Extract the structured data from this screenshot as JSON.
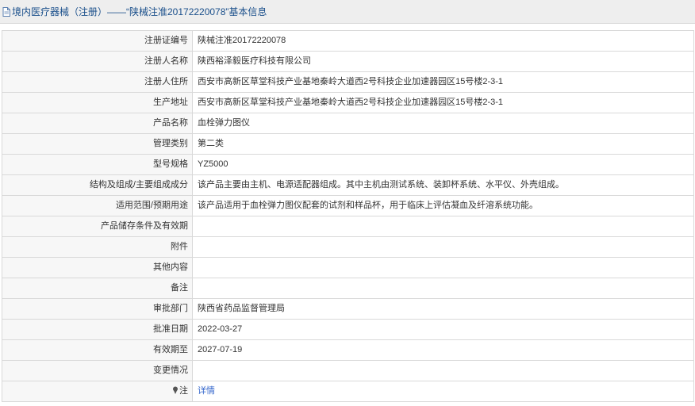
{
  "header": {
    "title": "境内医疗器械（注册）——“陕械注准20172220078”基本信息"
  },
  "rows": [
    {
      "label": "注册证编号",
      "value": "陕械注准20172220078"
    },
    {
      "label": "注册人名称",
      "value": "陕西裕泽毅医疗科技有限公司"
    },
    {
      "label": "注册人住所",
      "value": "西安市高新区草堂科技产业基地秦岭大道西2号科技企业加速器园区15号楼2-3-1"
    },
    {
      "label": "生产地址",
      "value": "西安市高新区草堂科技产业基地秦岭大道西2号科技企业加速器园区15号楼2-3-1"
    },
    {
      "label": "产品名称",
      "value": "血栓弹力图仪"
    },
    {
      "label": "管理类别",
      "value": "第二类"
    },
    {
      "label": "型号规格",
      "value": "YZ5000"
    },
    {
      "label": "结构及组成/主要组成成分",
      "value": "该产品主要由主机、电源适配器组成。其中主机由测试系统、装卸杯系统、水平仪、外壳组成。"
    },
    {
      "label": "适用范围/预期用途",
      "value": "该产品适用于血栓弹力图仪配套的试剂和样品杯，用于临床上评估凝血及纤溶系统功能。"
    },
    {
      "label": "产品储存条件及有效期",
      "value": ""
    },
    {
      "label": "附件",
      "value": ""
    },
    {
      "label": "其他内容",
      "value": ""
    },
    {
      "label": "备注",
      "value": ""
    },
    {
      "label": "审批部门",
      "value": "陕西省药品监督管理局"
    },
    {
      "label": "批准日期",
      "value": "2022-03-27"
    },
    {
      "label": "有效期至",
      "value": "2027-07-19"
    },
    {
      "label": "变更情况",
      "value": ""
    }
  ],
  "note": {
    "label": "注",
    "link": "详情",
    "icon": "pin-icon"
  },
  "colors": {
    "title": "#1a4f8b",
    "link": "#3366cc",
    "border": "#d9d9d9",
    "label_bg": "#f7f7f7"
  }
}
